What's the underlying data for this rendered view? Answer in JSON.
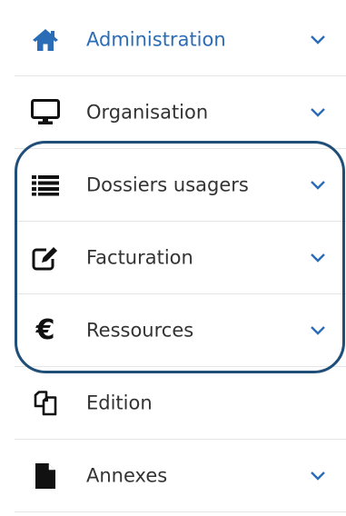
{
  "menu": {
    "items": [
      {
        "label": "Administration",
        "icon": "home-icon",
        "active": true,
        "has_chevron": true
      },
      {
        "label": "Organisation",
        "icon": "monitor-icon",
        "active": false,
        "has_chevron": true
      },
      {
        "label": "Dossiers usagers",
        "icon": "list-icon",
        "active": false,
        "has_chevron": true
      },
      {
        "label": "Facturation",
        "icon": "edit-icon",
        "active": false,
        "has_chevron": true
      },
      {
        "label": "Ressources",
        "icon": "euro-icon",
        "euro_symbol": "€",
        "active": false,
        "has_chevron": true
      },
      {
        "label": "Edition",
        "icon": "copy-icon",
        "active": false,
        "has_chevron": false
      },
      {
        "label": "Annexes",
        "icon": "file-icon",
        "active": false,
        "has_chevron": true
      }
    ]
  },
  "highlight": {
    "items": [
      "Dossiers usagers",
      "Facturation",
      "Ressources"
    ],
    "color": "#1f4e79"
  },
  "colors": {
    "active_text": "#2b6cb6",
    "text": "#333333",
    "icon": "#111111",
    "chevron": "#2b6cb6",
    "divider": "#e6e6e6"
  }
}
